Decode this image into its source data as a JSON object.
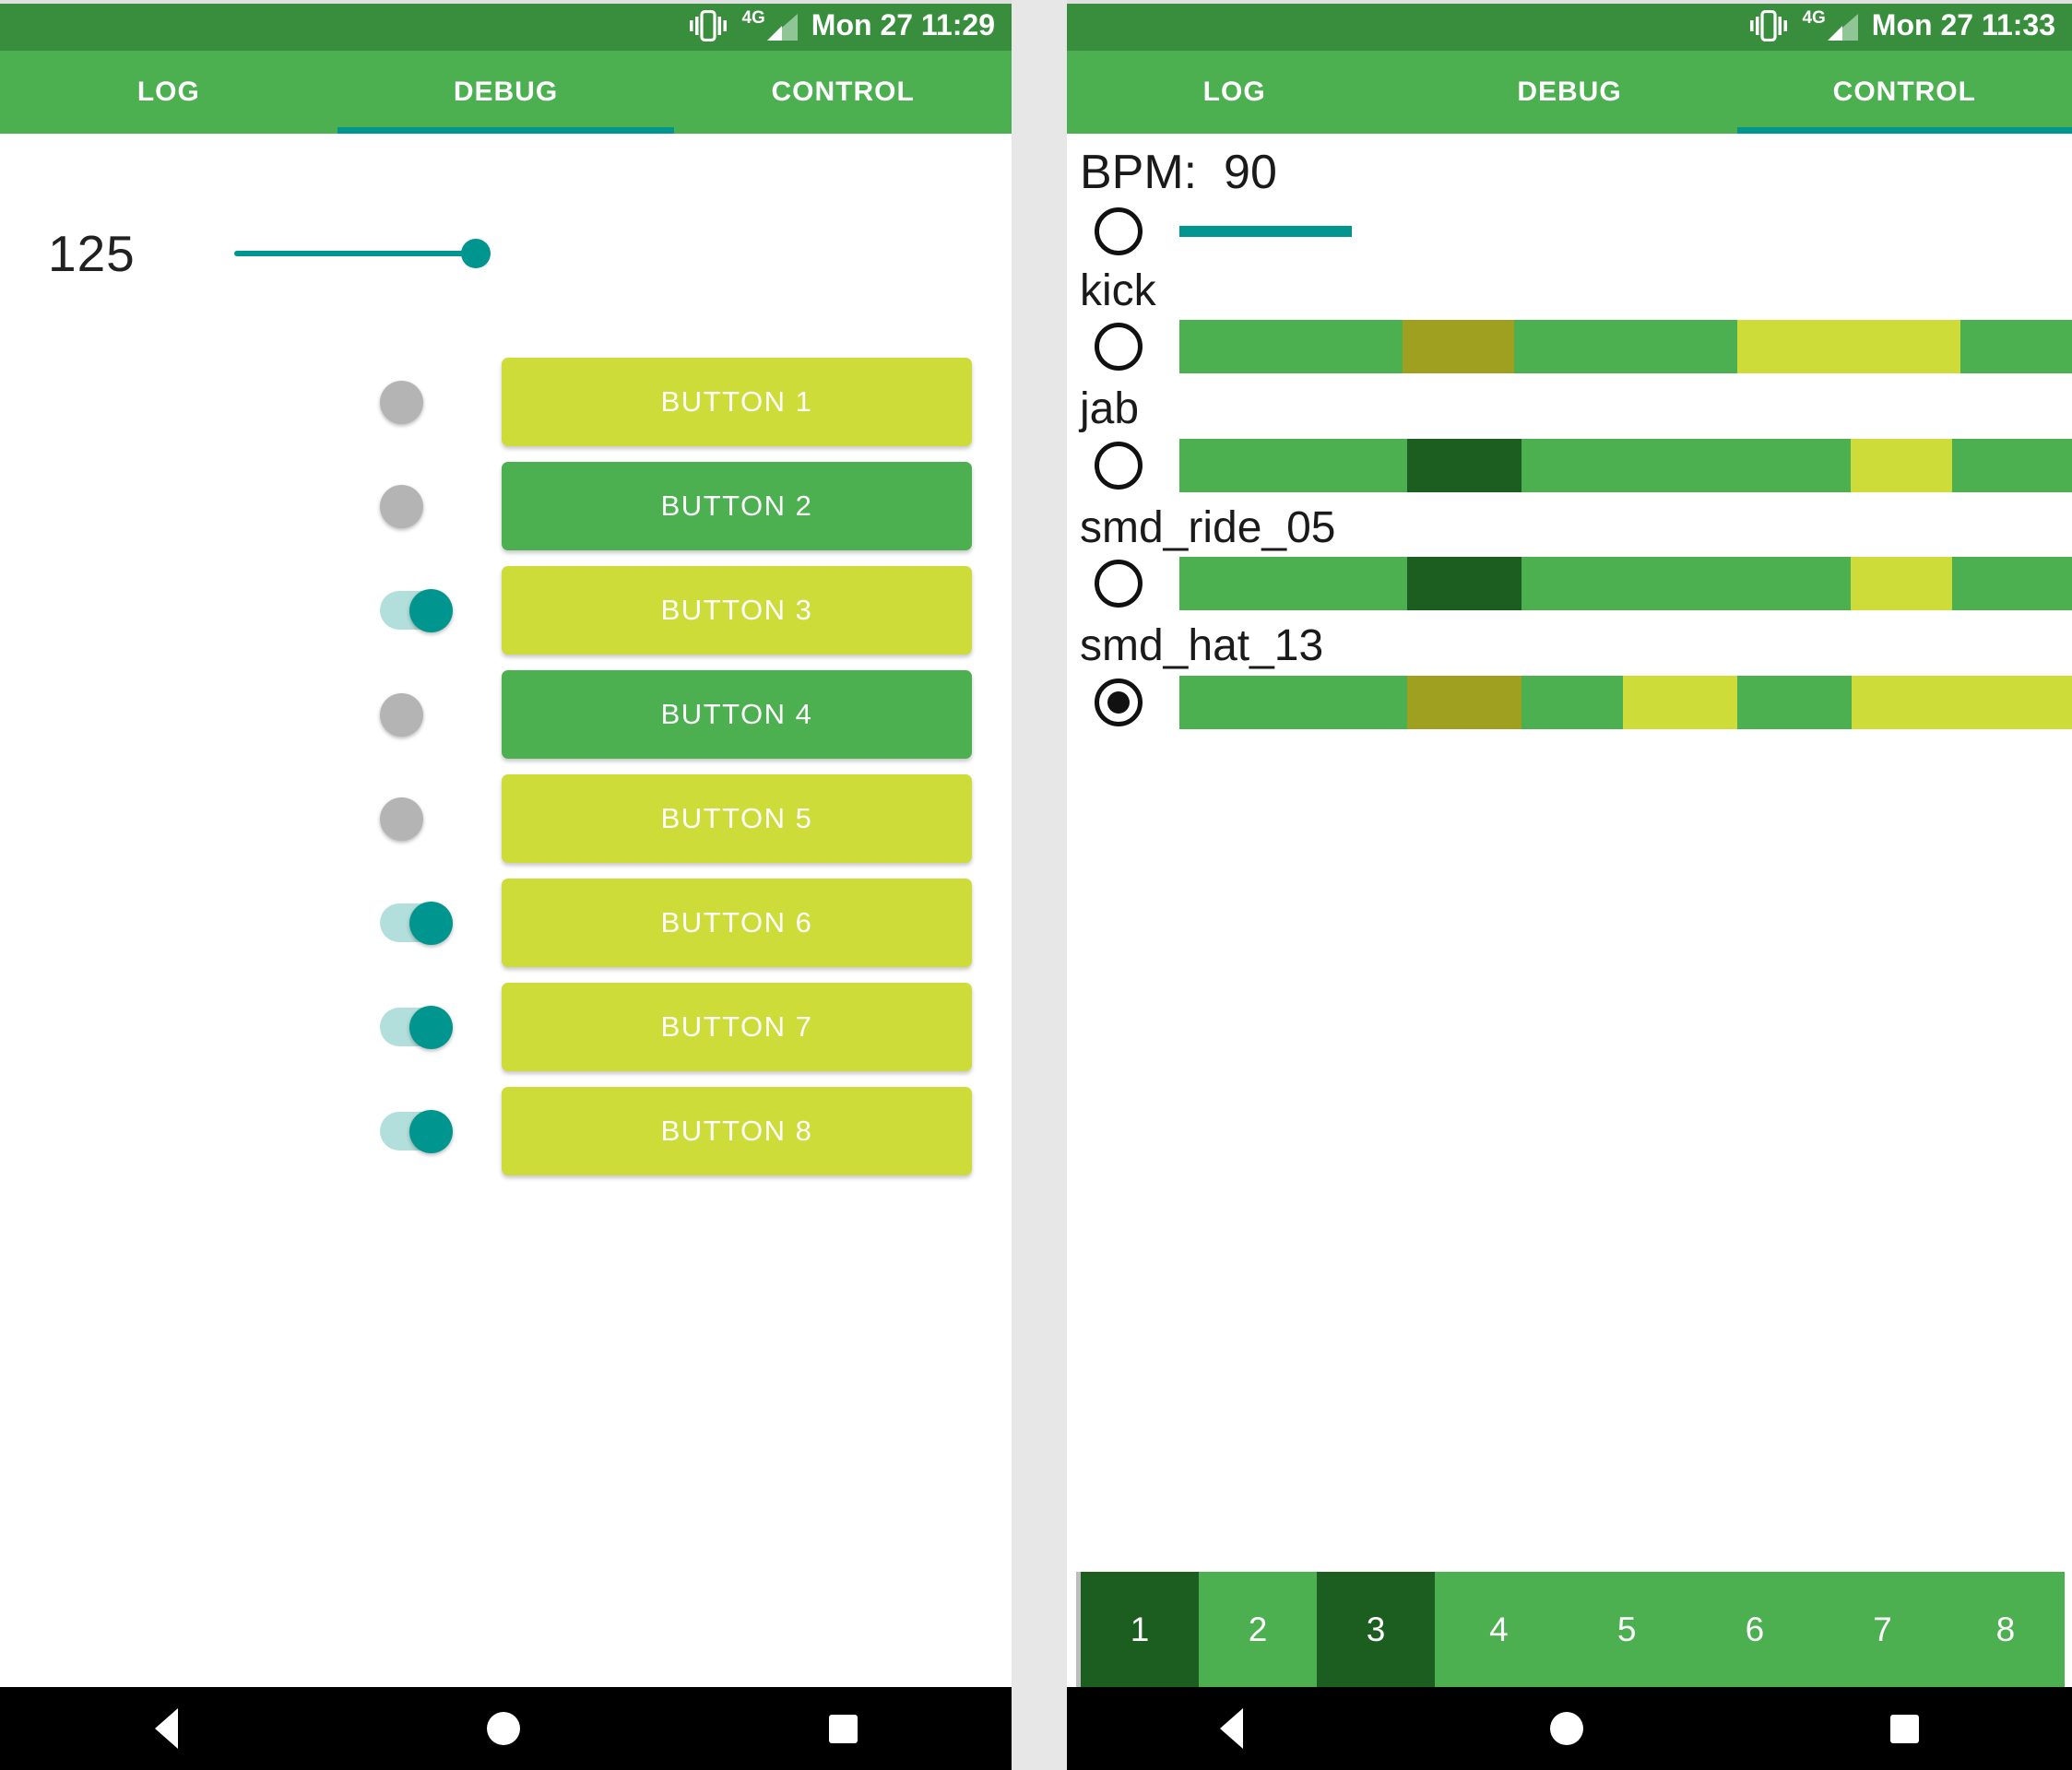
{
  "theme": {
    "status_bar_bg": "#388e3c",
    "tab_bar_bg": "#4caf50",
    "accent_teal": "#00968f",
    "button_on": "#cddc39",
    "button_off": "#4caf50",
    "switch_off_thumb": "#b4b4b4",
    "switch_on_track": "#b2dfdb",
    "step_active": "#1b5e20",
    "step_inactive": "#4caf50"
  },
  "left_phone": {
    "status": {
      "time": "Mon 27 11:29",
      "icons": [
        "vibrate-icon",
        "signal-4g-icon"
      ],
      "network_label": "4G"
    },
    "tabs": [
      {
        "label": "LOG",
        "active": false
      },
      {
        "label": "DEBUG",
        "active": true
      },
      {
        "label": "CONTROL",
        "active": false
      }
    ],
    "slider": {
      "value": "125",
      "position_percent": 100
    },
    "rows": [
      {
        "switch_on": false,
        "button_label": "BUTTON 1",
        "button_color": "#cddc39"
      },
      {
        "switch_on": false,
        "button_label": "BUTTON 2",
        "button_color": "#4caf50"
      },
      {
        "switch_on": true,
        "button_label": "BUTTON 3",
        "button_color": "#cddc39"
      },
      {
        "switch_on": false,
        "button_label": "BUTTON 4",
        "button_color": "#4caf50"
      },
      {
        "switch_on": false,
        "button_label": "BUTTON 5",
        "button_color": "#cddc39"
      },
      {
        "switch_on": true,
        "button_label": "BUTTON 6",
        "button_color": "#cddc39"
      },
      {
        "switch_on": true,
        "button_label": "BUTTON 7",
        "button_color": "#cddc39"
      },
      {
        "switch_on": true,
        "button_label": "BUTTON 8",
        "button_color": "#cddc39"
      }
    ]
  },
  "right_phone": {
    "status": {
      "time": "Mon 27 11:33",
      "icons": [
        "vibrate-icon",
        "signal-4g-icon"
      ],
      "network_label": "4G"
    },
    "tabs": [
      {
        "label": "LOG",
        "active": false
      },
      {
        "label": "DEBUG",
        "active": false
      },
      {
        "label": "CONTROL",
        "active": true
      }
    ],
    "bpm": {
      "label": "BPM:  90",
      "value": "90",
      "radio_checked": false,
      "bar_width_percent": 24
    },
    "tracks": [
      {
        "name": "kick",
        "radio_checked": false,
        "segments": [
          {
            "width_percent": 25.0,
            "color": "#4caf50"
          },
          {
            "width_percent": 12.5,
            "color": "#a0a020"
          },
          {
            "width_percent": 25.0,
            "color": "#4caf50"
          },
          {
            "width_percent": 25.0,
            "color": "#cddc39"
          },
          {
            "width_percent": 12.5,
            "color": "#4caf50"
          }
        ]
      },
      {
        "name": "jab",
        "radio_checked": false,
        "segments": [
          {
            "width_percent": 25.5,
            "color": "#4caf50"
          },
          {
            "width_percent": 12.8,
            "color": "#1b5e20"
          },
          {
            "width_percent": 36.9,
            "color": "#4caf50"
          },
          {
            "width_percent": 11.4,
            "color": "#cddc39"
          },
          {
            "width_percent": 13.4,
            "color": "#4caf50"
          }
        ]
      },
      {
        "name": "smd_ride_05",
        "radio_checked": false,
        "segments": [
          {
            "width_percent": 25.5,
            "color": "#4caf50"
          },
          {
            "width_percent": 12.8,
            "color": "#1b5e20"
          },
          {
            "width_percent": 36.9,
            "color": "#4caf50"
          },
          {
            "width_percent": 11.4,
            "color": "#cddc39"
          },
          {
            "width_percent": 13.4,
            "color": "#4caf50"
          }
        ]
      },
      {
        "name": "smd_hat_13",
        "radio_checked": true,
        "segments": [
          {
            "width_percent": 25.5,
            "color": "#4caf50"
          },
          {
            "width_percent": 12.8,
            "color": "#a0a020"
          },
          {
            "width_percent": 11.4,
            "color": "#4caf50"
          },
          {
            "width_percent": 12.8,
            "color": "#cddc39"
          },
          {
            "width_percent": 12.8,
            "color": "#4caf50"
          },
          {
            "width_percent": 24.7,
            "color": "#cddc39"
          }
        ]
      }
    ],
    "steps": [
      {
        "label": "1",
        "active": true
      },
      {
        "label": "2",
        "active": false
      },
      {
        "label": "3",
        "active": true
      },
      {
        "label": "4",
        "active": false
      },
      {
        "label": "5",
        "active": false
      },
      {
        "label": "6",
        "active": false
      },
      {
        "label": "7",
        "active": false
      },
      {
        "label": "8",
        "active": false
      }
    ]
  },
  "navbar": {
    "back": "back-triangle-icon",
    "home": "home-circle-icon",
    "recent": "recent-square-icon"
  }
}
